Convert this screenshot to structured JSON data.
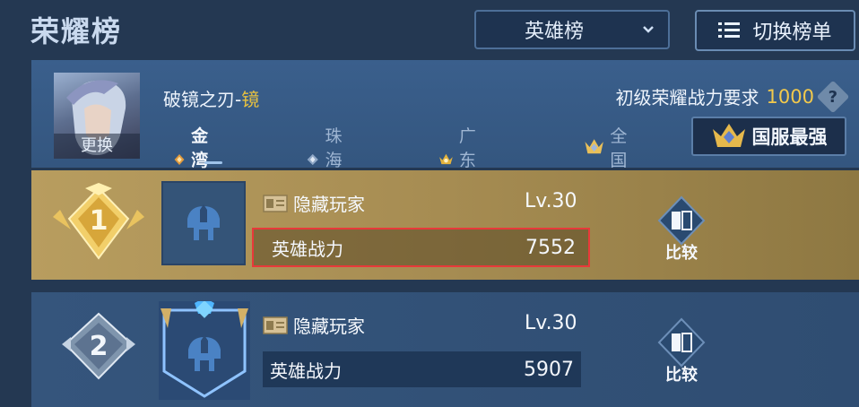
{
  "header": {
    "title": "荣耀榜",
    "dropdown_selected": "英雄榜",
    "switch_label": "切换榜单"
  },
  "profile": {
    "avatar_label": "更换",
    "hero_name": "破镜之刃",
    "hero_sep": "-",
    "hero_skin": "镜",
    "requirement_label": "初级荣耀战力要求",
    "requirement_value": "1000",
    "help_glyph": "?",
    "regions": [
      "金湾区",
      "珠海市",
      "广东省",
      "全国"
    ],
    "top_button_label": "国服最强"
  },
  "ranking": [
    {
      "rank": "1",
      "name": "隐藏玩家",
      "level": "Lv.30",
      "power_label": "英雄战力",
      "power": "7552",
      "compare_label": "比较"
    },
    {
      "rank": "2",
      "name": "隐藏玩家",
      "level": "Lv.30",
      "power_label": "英雄战力",
      "power": "5907",
      "compare_label": "比较"
    }
  ],
  "colors": {
    "background": "#243852",
    "accent_gold": "#f2c94c",
    "highlight_border": "#e8393a"
  }
}
